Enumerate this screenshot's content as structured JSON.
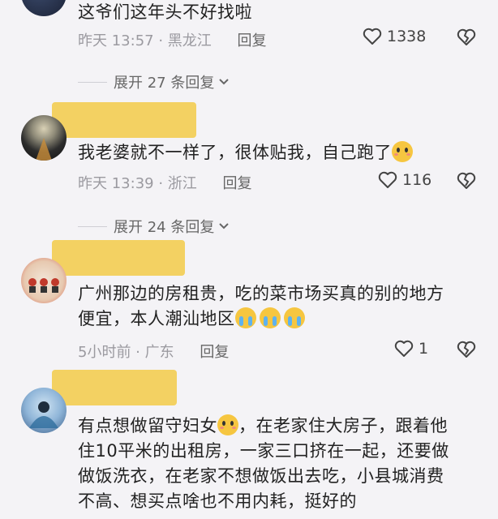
{
  "comments": [
    {
      "text": "这爷们这年头不好找啦",
      "time_location": "昨天 13:57 · 黑龙江",
      "reply_label": "回复",
      "like_count": "1338",
      "expand_label": "展开 27 条回复"
    },
    {
      "text": "我老婆就不一样了，很体贴我，自己跑了",
      "time_location": "昨天 13:39 · 浙江",
      "reply_label": "回复",
      "like_count": "116",
      "expand_label": "展开 24 条回复"
    },
    {
      "text": "广州那边的房租贵，吃的菜市场买真的别的地方便宜，本人潮汕地区",
      "time_location": "5小时前 · 广东",
      "reply_label": "回复",
      "like_count": "1"
    },
    {
      "text_part1": "有点想做留守妇女",
      "text_part2": "，在老家住大房子，跟着他住10平米的出租房，一家三口挤在一起，还要做做饭洗衣，在老家不想做饭出去吃，小县城消费不高、想买点啥也不用内耗，挺好的"
    }
  ],
  "icons": {
    "like": "heart-outline-icon",
    "dislike": "broken-heart-icon",
    "expand": "chevron-down-icon"
  },
  "colors": {
    "background": "#f4f3f6",
    "name_redaction": "#f3cd52",
    "meta_text": "#9b9aa0"
  }
}
